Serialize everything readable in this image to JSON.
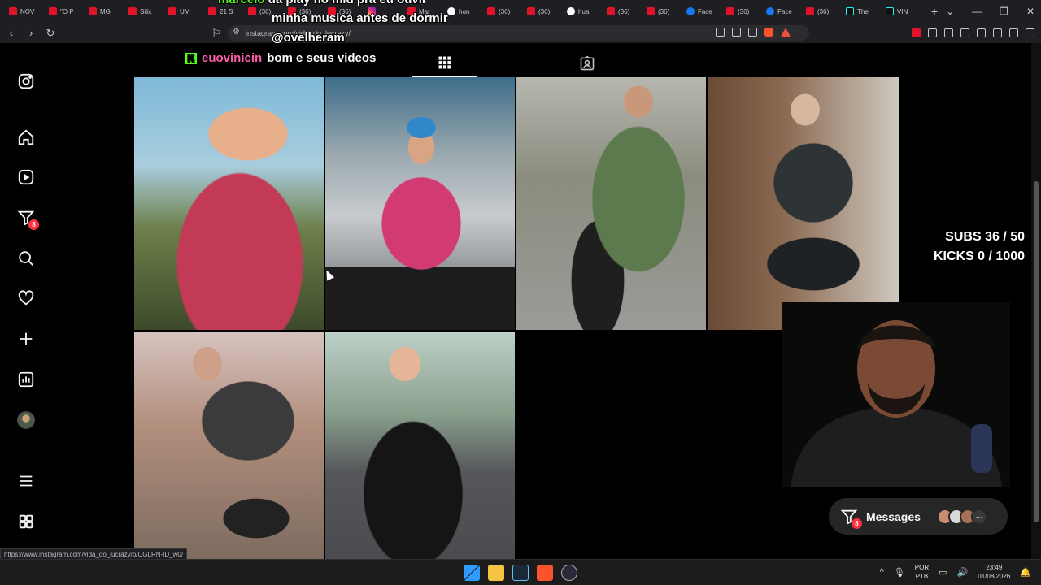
{
  "browser": {
    "tabs": [
      {
        "label": "NOV",
        "icon": "youtube"
      },
      {
        "label": "\"O P",
        "icon": "youtube"
      },
      {
        "label": "MG",
        "icon": "youtube"
      },
      {
        "label": "Silic",
        "icon": "youtube"
      },
      {
        "label": "UM",
        "icon": "youtube"
      },
      {
        "label": "21 S",
        "icon": "youtube"
      },
      {
        "label": "(36)",
        "icon": "youtube"
      },
      {
        "label": "(36)",
        "icon": "youtube"
      },
      {
        "label": "(36)",
        "icon": "youtube"
      },
      {
        "label": "",
        "icon": "instagram"
      },
      {
        "label": "Mar",
        "icon": "youtube"
      },
      {
        "label": "hon",
        "icon": "google"
      },
      {
        "label": "(36)",
        "icon": "youtube"
      },
      {
        "label": "(36)",
        "icon": "youtube"
      },
      {
        "label": "hua",
        "icon": "google"
      },
      {
        "label": "(36)",
        "icon": "youtube"
      },
      {
        "label": "(36)",
        "icon": "youtube"
      },
      {
        "label": "Face",
        "icon": "facebook"
      },
      {
        "label": "(36)",
        "icon": "youtube"
      },
      {
        "label": "Face",
        "icon": "facebook"
      },
      {
        "label": "(36)",
        "icon": "youtube"
      },
      {
        "label": "The",
        "icon": "tiktok"
      },
      {
        "label": "VIN",
        "icon": "tiktok"
      }
    ],
    "new_tab": "+",
    "url": "instagram.com/vida_do_lucrazy/",
    "status_url": "https://www.instagram.com/vida_do_lucrazy/p/CGLRN-ID_w0/"
  },
  "stream_overlay": {
    "chat1_user": "marcelo",
    "chat1_text": "da play no mid pra eu ouvir",
    "chat1_line2": "minha musica antes de dormir",
    "chat1_line3": "@ovelheram",
    "chat2_user": "euovinicin",
    "chat2_text": "bom e seus videos",
    "subs": "SUBS 36 / 50",
    "kicks": "KICKS 0 / 1000"
  },
  "sidebar": {
    "items": [
      {
        "name": "instagram-logo",
        "icon": "instagram-icon"
      },
      {
        "name": "home",
        "icon": "home-icon"
      },
      {
        "name": "reels",
        "icon": "reels-icon"
      },
      {
        "name": "messages",
        "icon": "messenger-icon",
        "badge": "8"
      },
      {
        "name": "search",
        "icon": "search-icon"
      },
      {
        "name": "notifications",
        "icon": "heart-icon"
      },
      {
        "name": "create",
        "icon": "plus-icon"
      },
      {
        "name": "dashboard",
        "icon": "dashboard-icon"
      },
      {
        "name": "profile",
        "icon": "avatar"
      },
      {
        "name": "more",
        "icon": "menu-icon"
      },
      {
        "name": "also-from-meta",
        "icon": "apps-icon"
      }
    ]
  },
  "messages_panel": {
    "label": "Messages",
    "badge": "8",
    "more": "···"
  },
  "taskbar": {
    "lang_top": "POR",
    "lang_bottom": "PTB",
    "time": "23:49",
    "date": "01/08/2026",
    "tray_chevron": "^"
  },
  "colors": {
    "kick_green": "#53fc18",
    "instagram_badge": "#ff3040",
    "background": "#000000"
  }
}
